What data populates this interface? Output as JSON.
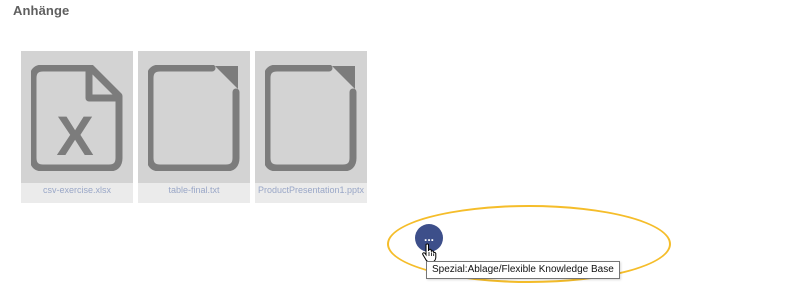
{
  "section": {
    "title": "Anhänge"
  },
  "attachments": [
    {
      "filename": "csv-exercise.xlsx",
      "icon": "excel-file-icon"
    },
    {
      "filename": "table-final.txt",
      "icon": "document-file-icon"
    },
    {
      "filename": "ProductPresentation1.pptx",
      "icon": "document-file-icon"
    }
  ],
  "more_button": {
    "label": "...",
    "icon": "more-options-icon"
  },
  "tooltip": {
    "text": "Spezial:Ablage/Flexible Knowledge Base"
  },
  "colors": {
    "tile_background": "#d3d3d3",
    "icon_gray": "#7c7c7c",
    "filename_text": "#9aa7c7",
    "more_button": "#3d4f8a",
    "highlight": "#f5bd2a"
  }
}
